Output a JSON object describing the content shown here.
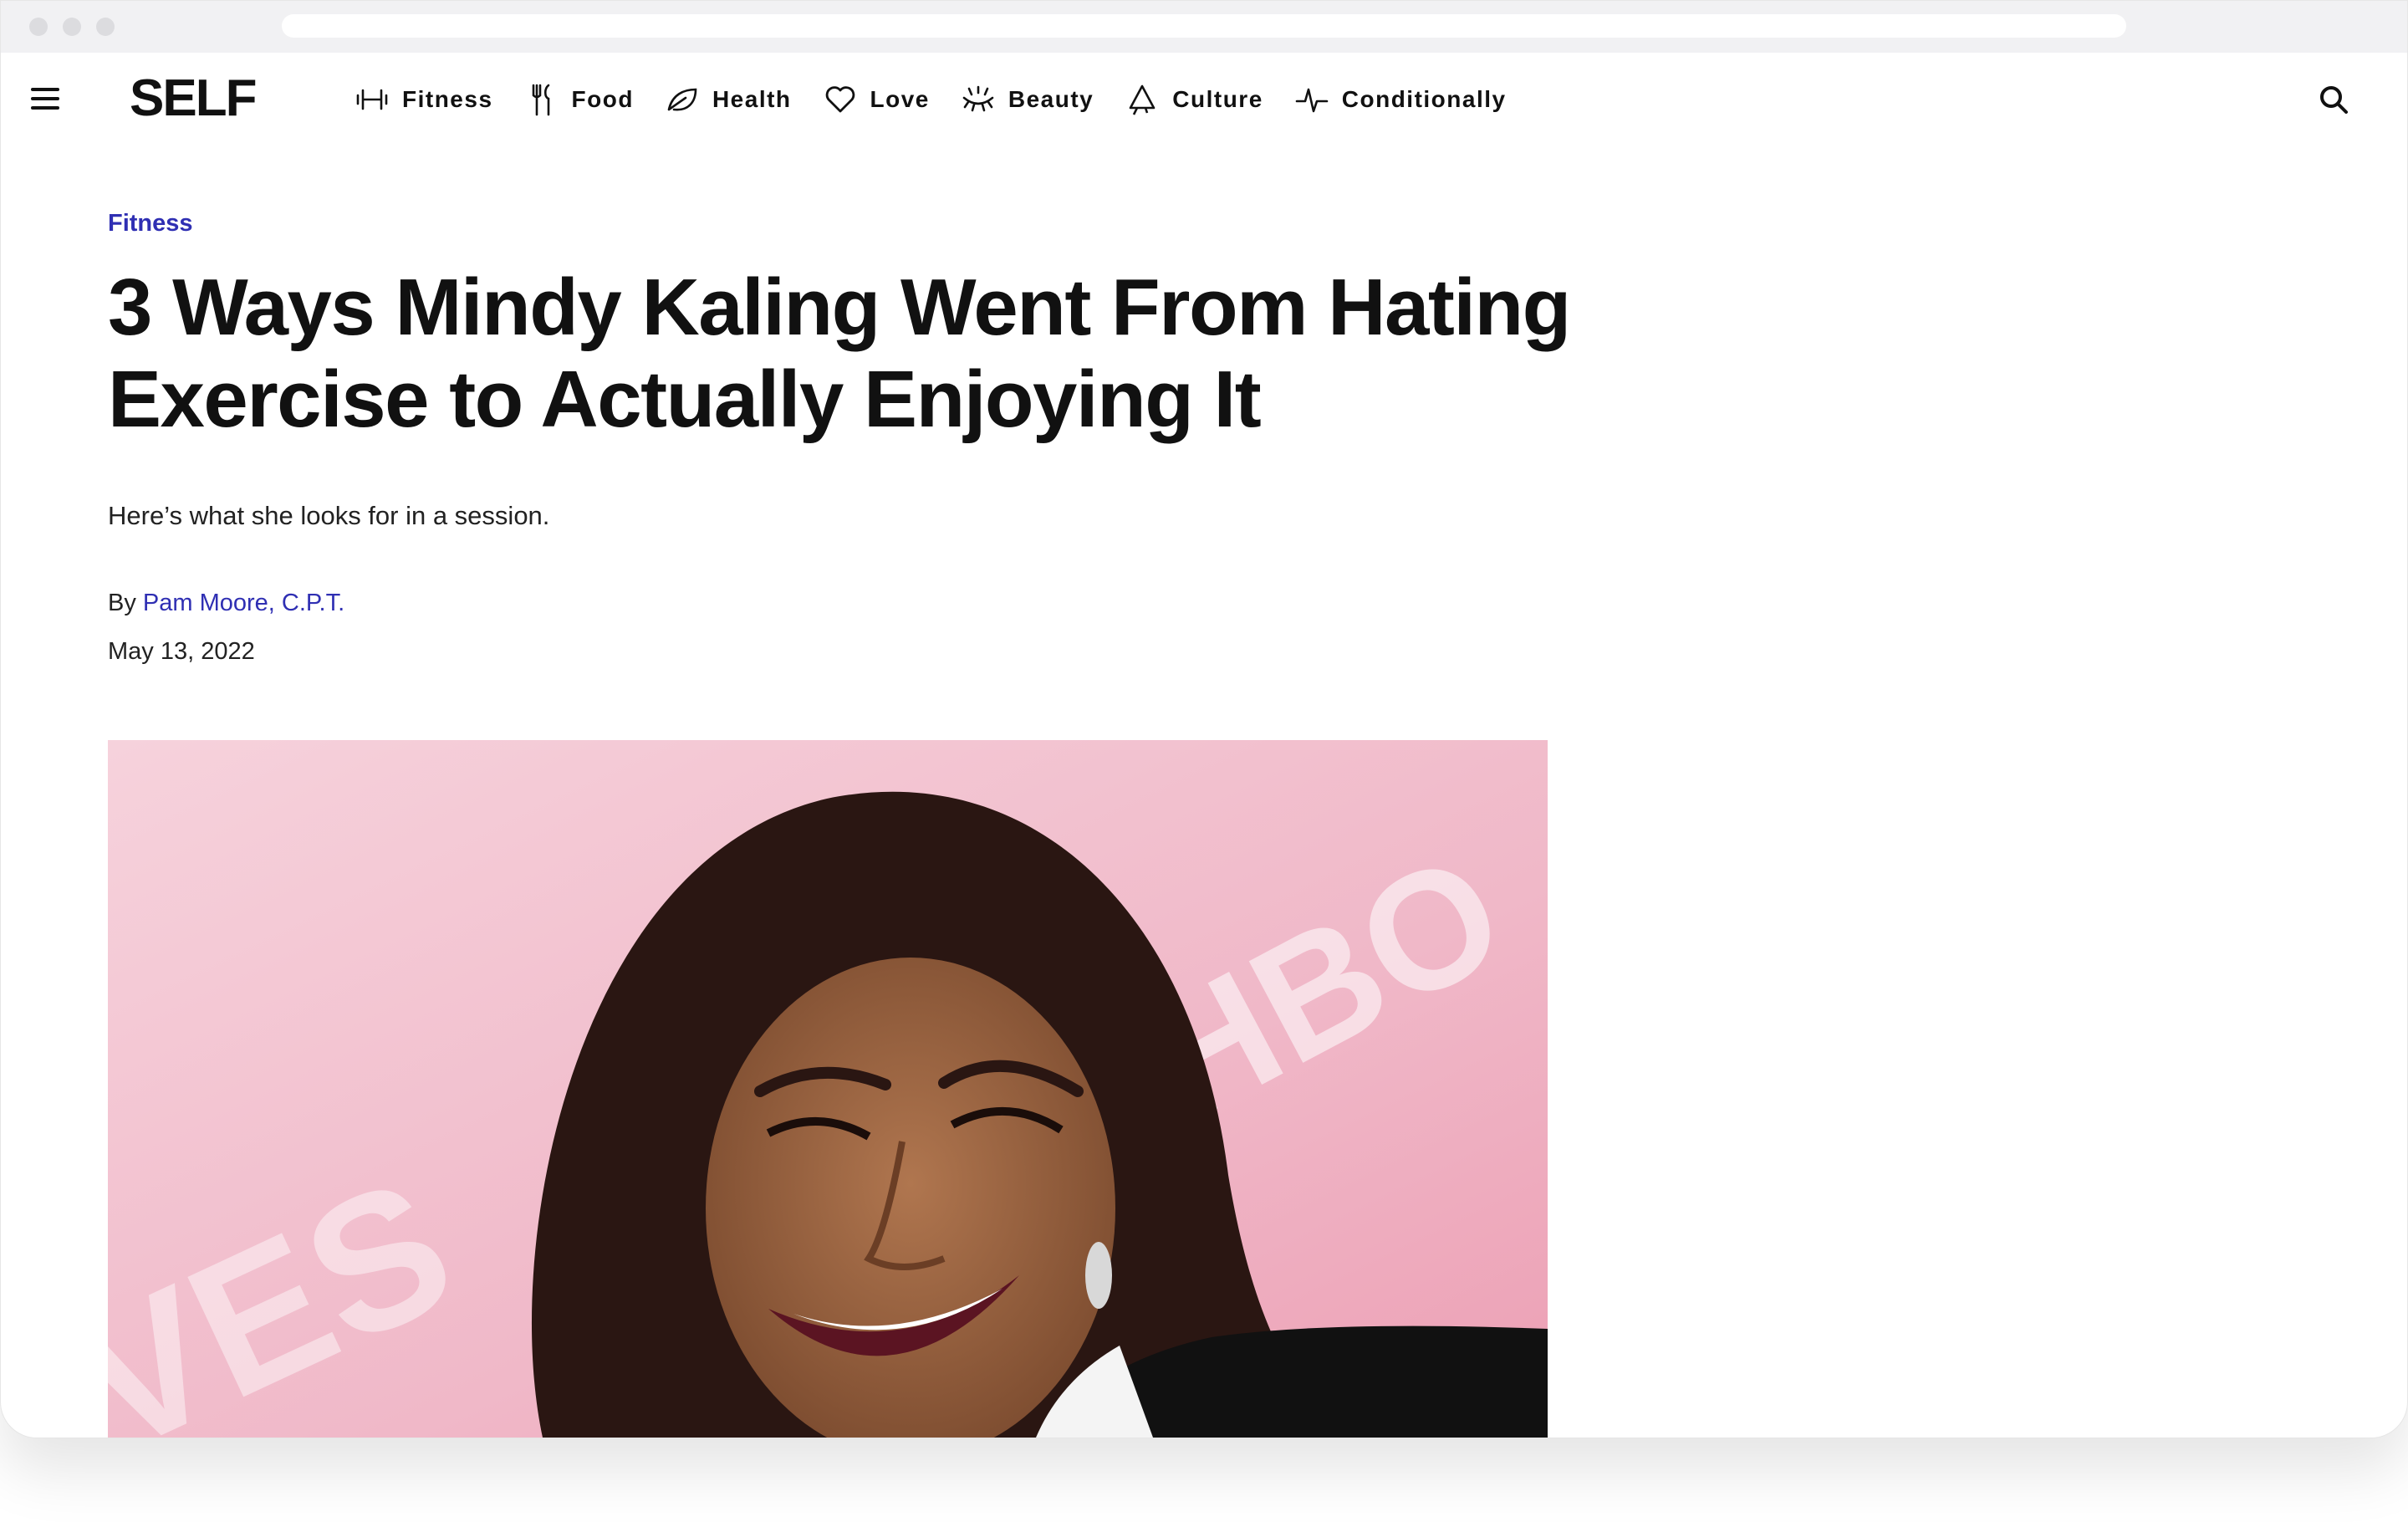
{
  "brand": {
    "logo": "SELF"
  },
  "nav": {
    "items": [
      {
        "label": "Fitness",
        "icon": "dumbbell-icon"
      },
      {
        "label": "Food",
        "icon": "fork-knife-icon"
      },
      {
        "label": "Health",
        "icon": "leaf-icon"
      },
      {
        "label": "Love",
        "icon": "heart-icon"
      },
      {
        "label": "Beauty",
        "icon": "eyelash-icon"
      },
      {
        "label": "Culture",
        "icon": "megaphone-icon"
      },
      {
        "label": "Conditionally",
        "icon": "pulse-icon"
      }
    ],
    "menu_icon": "hamburger-menu-icon",
    "search_icon": "search-icon"
  },
  "article": {
    "category": "Fitness",
    "headline": "3 Ways Mindy Kaling Went From Hating Exercise to Actually Enjoying It",
    "dek": "Here’s what she looks for in a session.",
    "byline_prefix": "By",
    "author": "Pam Moore, C.P.T.",
    "date": "May 13, 2022",
    "hero_backdrop_text": "HBO"
  },
  "colors": {
    "accent": "#2f2fb3",
    "text": "#111111",
    "hero_background": "#f2c6d2"
  }
}
